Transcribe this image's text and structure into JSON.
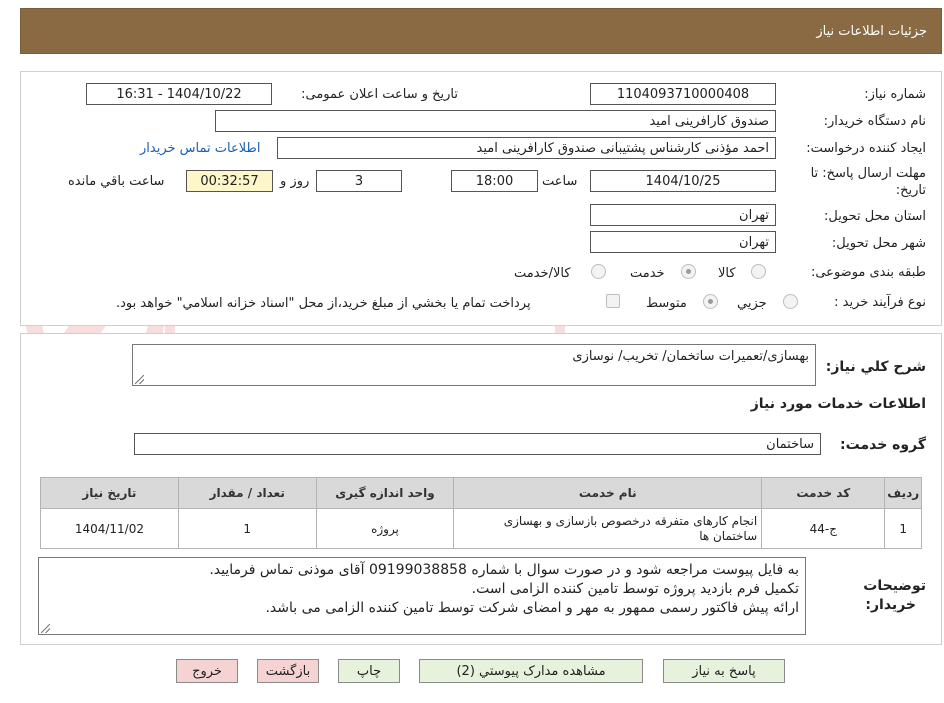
{
  "window": {
    "title": "جزئیات اطلاعات نیاز"
  },
  "labels": {
    "need_number": "شماره نیاز:",
    "announce_datetime": "تاریخ و ساعت اعلان عمومی:",
    "buyer_org": "نام دستگاه خریدار:",
    "requester": "ایجاد کننده درخواست:",
    "deadline_line1": "مهلت ارسال پاسخ: تا",
    "deadline_line2": "تاریخ:",
    "time_word": "ساعت",
    "days_and": "روز و",
    "remaining": "ساعت باقي مانده",
    "province": "استان محل تحویل:",
    "city": "شهر محل تحویل:",
    "category": "طبقه بندی موضوعی:",
    "process_type": "نوع فرآیند خرید :",
    "summary": "شرح کلي نياز:",
    "services_info": "اطلاعات خدمات مورد نياز",
    "service_group": "گروه خدمت:",
    "buyer_notes_l1": "توضيحات",
    "buyer_notes_l2": "خريدار:"
  },
  "fields": {
    "need_number": "1104093710000408",
    "announce_datetime": "1404/10/22 - 16:31",
    "buyer_org": "صندوق کارافرینی امید",
    "requester": "احمد مؤذنی کارشناس پشتیبانی صندوق کارافرینی امید",
    "contact_link": "اطلاعات تماس خریدار",
    "deadline_date": "1404/10/25",
    "deadline_time": "18:00",
    "days": "3",
    "countdown": "00:32:57",
    "province": "تهران",
    "city": "تهران",
    "summary": "بهسازی/تعمیرات ساتخمان/ تخریب/ نوسازی",
    "service_group": "ساختمان"
  },
  "category_options": [
    {
      "label": "کالا",
      "selected": false
    },
    {
      "label": "خدمت",
      "selected": true
    },
    {
      "label": "کالا/خدمت",
      "selected": false
    }
  ],
  "process_options": [
    {
      "label": "جزيي",
      "selected": false
    },
    {
      "label": "متوسط",
      "selected": true
    }
  ],
  "payment_note": "پرداخت تمام يا بخشي از مبلغ خريد،از محل \"اسناد خزانه اسلامي\" خواهد بود.",
  "table": {
    "headers": [
      "رديف",
      "کد خدمت",
      "نام خدمت",
      "واحد اندازه گيری",
      "تعداد / مقدار",
      "تاريخ نياز"
    ],
    "rows": [
      [
        "1",
        "ج-44",
        "انجام کارهای متفرقه درخصوص بازسازی و بهسازی ساختمان ها",
        "پروژه",
        "1",
        "1404/11/02"
      ]
    ]
  },
  "buyer_notes": [
    "به فایل پیوست مراجعه شود و در صورت سوال با شماره 09199038858 آقای موذنی تماس فرمایید.",
    "تکمیل فرم بازدید پروژه توسط تامین کننده الزامی است.",
    "ارائه پیش فاکتور رسمی ممهور به مهر و امضای شرکت توسط تامین کننده الزامی می باشد."
  ],
  "buttons": {
    "reply": "پاسخ به نياز",
    "attachments": "مشاهده مدارک پيوستي (2)",
    "print": "چاپ",
    "back": "بازگشت",
    "exit": "خروج"
  },
  "colors": {
    "titlebar": "#8a6a43",
    "link": "#1a5fb4",
    "countdown_bg": "#fdf6c9",
    "button_green": "#e6f2dc",
    "button_pink": "#f6d3d3"
  }
}
